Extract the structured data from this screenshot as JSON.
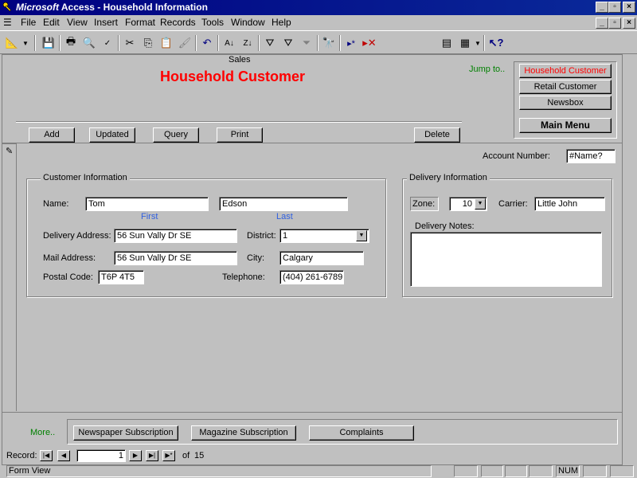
{
  "window": {
    "app_name": "Microsoft",
    "title": "Access - Household Information"
  },
  "menu": [
    "File",
    "Edit",
    "View",
    "Insert",
    "Format",
    "Records",
    "Tools",
    "Window",
    "Help"
  ],
  "header": {
    "section_label": "Sales",
    "form_title": "Household Customer",
    "jump_to_label": "Jump to..",
    "jump_buttons": {
      "household": "Household Customer",
      "retail": "Retail Customer",
      "newsbox": "Newsbox",
      "main_menu": "Main Menu"
    },
    "actions": {
      "add": "Add",
      "updated": "Updated",
      "query": "Query",
      "print": "Print",
      "delete": "Delete"
    }
  },
  "account": {
    "label": "Account Number:",
    "value": "#Name?"
  },
  "customer_info": {
    "group_title": "Customer Information",
    "name_label": "Name:",
    "first_name": "Tom",
    "last_name": "Edson",
    "first_caption": "First",
    "last_caption": "Last",
    "delivery_address_label": "Delivery Address:",
    "delivery_address": "56 Sun Vally Dr SE",
    "district_label": "District:",
    "district": "1",
    "mail_address_label": "Mail Address:",
    "mail_address": "56 Sun Vally Dr SE",
    "city_label": "City:",
    "city": "Calgary",
    "postal_code_label": "Postal Code:",
    "postal_code": "T6P 4T5",
    "telephone_label": "Telephone:",
    "telephone": "(404) 261-6789"
  },
  "delivery_info": {
    "group_title": "Delivery Information",
    "zone_label": "Zone:",
    "zone": "10",
    "carrier_label": "Carrier:",
    "carrier": "Little John",
    "notes_label": "Delivery Notes:",
    "notes": ""
  },
  "footer": {
    "more_label": "More..",
    "newspaper_subscription": "Newspaper Subscription",
    "magazine_subscription": "Magazine Subscription",
    "complaints": "Complaints"
  },
  "navigation": {
    "record_label": "Record:",
    "current_record": "1",
    "of_label": "of",
    "total_records": "15"
  },
  "status_bar": {
    "text": "Form View",
    "num_indicator": "NUM"
  },
  "colors": {
    "title_red": "#ff0000",
    "jump_green": "#008000",
    "caption_blue": "#3060e0",
    "titlebar_blue": "#000080",
    "face_gray": "#c0c0c0"
  }
}
